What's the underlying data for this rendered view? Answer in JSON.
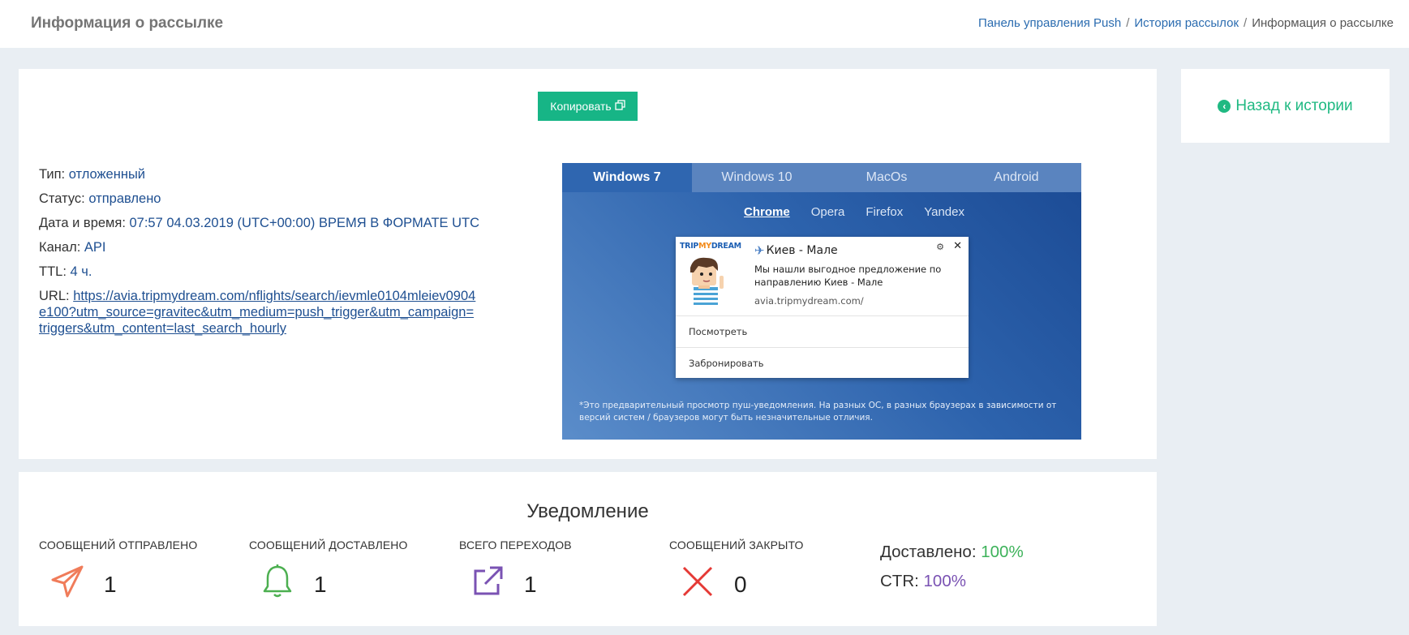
{
  "header": {
    "title": "Информация о рассылке",
    "breadcrumb": {
      "item1": "Панель управления Push",
      "sep": "/",
      "item2": "История рассылок",
      "current": "Информация о рассылке"
    }
  },
  "actions": {
    "copy_label": "Копировать",
    "copy_icon": "copy-icon",
    "back_label": "Назад к истории",
    "back_icon": "chevron-left-circle-icon"
  },
  "info": {
    "type_label": "Тип:",
    "type_value": "отложенный",
    "status_label": "Статус:",
    "status_value": "отправлено",
    "datetime_label": "Дата и время:",
    "datetime_value": "07:57 04.03.2019 (UTC+00:00) ВРЕМЯ В ФОРМАТЕ UTC",
    "channel_label": "Канал:",
    "channel_value": "API",
    "ttl_label": "TTL:",
    "ttl_value": "4 ч.",
    "url_label": "URL:",
    "url_value": "https://avia.tripmydream.com/nflights/search/ievmle0104mleiev0904e100?utm_source=gravitec&utm_medium=push_trigger&utm_campaign=triggers&utm_content=last_search_hourly"
  },
  "preview": {
    "os_tabs": [
      "Windows 7",
      "Windows 10",
      "MacOs",
      "Android"
    ],
    "browser_tabs": [
      "Chrome",
      "Opera",
      "Firefox",
      "Yandex"
    ],
    "notification": {
      "logo_trip": "TRIP",
      "logo_my": "MY",
      "logo_dream": "DREAM",
      "title": "Киев - Мале",
      "body": "Мы нашли выгодное предложение по направлению Киев - Мале",
      "domain": "avia.tripmydream.com/",
      "action1": "Посмотреть",
      "action2": "Забронировать"
    },
    "note": "*Это предварительный просмотр пуш-уведомления. На разных ОС, в разных браузерах в зависимости от версий систем / браузеров могут быть незначительные отличия."
  },
  "stats": {
    "title": "Уведомление",
    "sent_label": "СООБЩЕНИЙ ОТПРАВЛЕНО",
    "sent_value": "1",
    "delivered_label": "СООБЩЕНИЙ ДОСТАВЛЕНО",
    "delivered_value": "1",
    "clicks_label": "ВСЕГО ПЕРЕХОДОВ",
    "clicks_value": "1",
    "closed_label": "СООБЩЕНИЙ ЗАКРЫТО",
    "closed_value": "0",
    "delivered_pct_label": "Доставлено:",
    "delivered_pct_value": "100%",
    "ctr_label": "CTR:",
    "ctr_value": "100%"
  },
  "colors": {
    "accent_green": "#17b586",
    "link_blue": "#1e4f91",
    "sent_icon": "#f07c5a",
    "delivered_icon": "#4caf50",
    "clicks_icon": "#7a52b3",
    "closed_icon": "#e53935"
  }
}
